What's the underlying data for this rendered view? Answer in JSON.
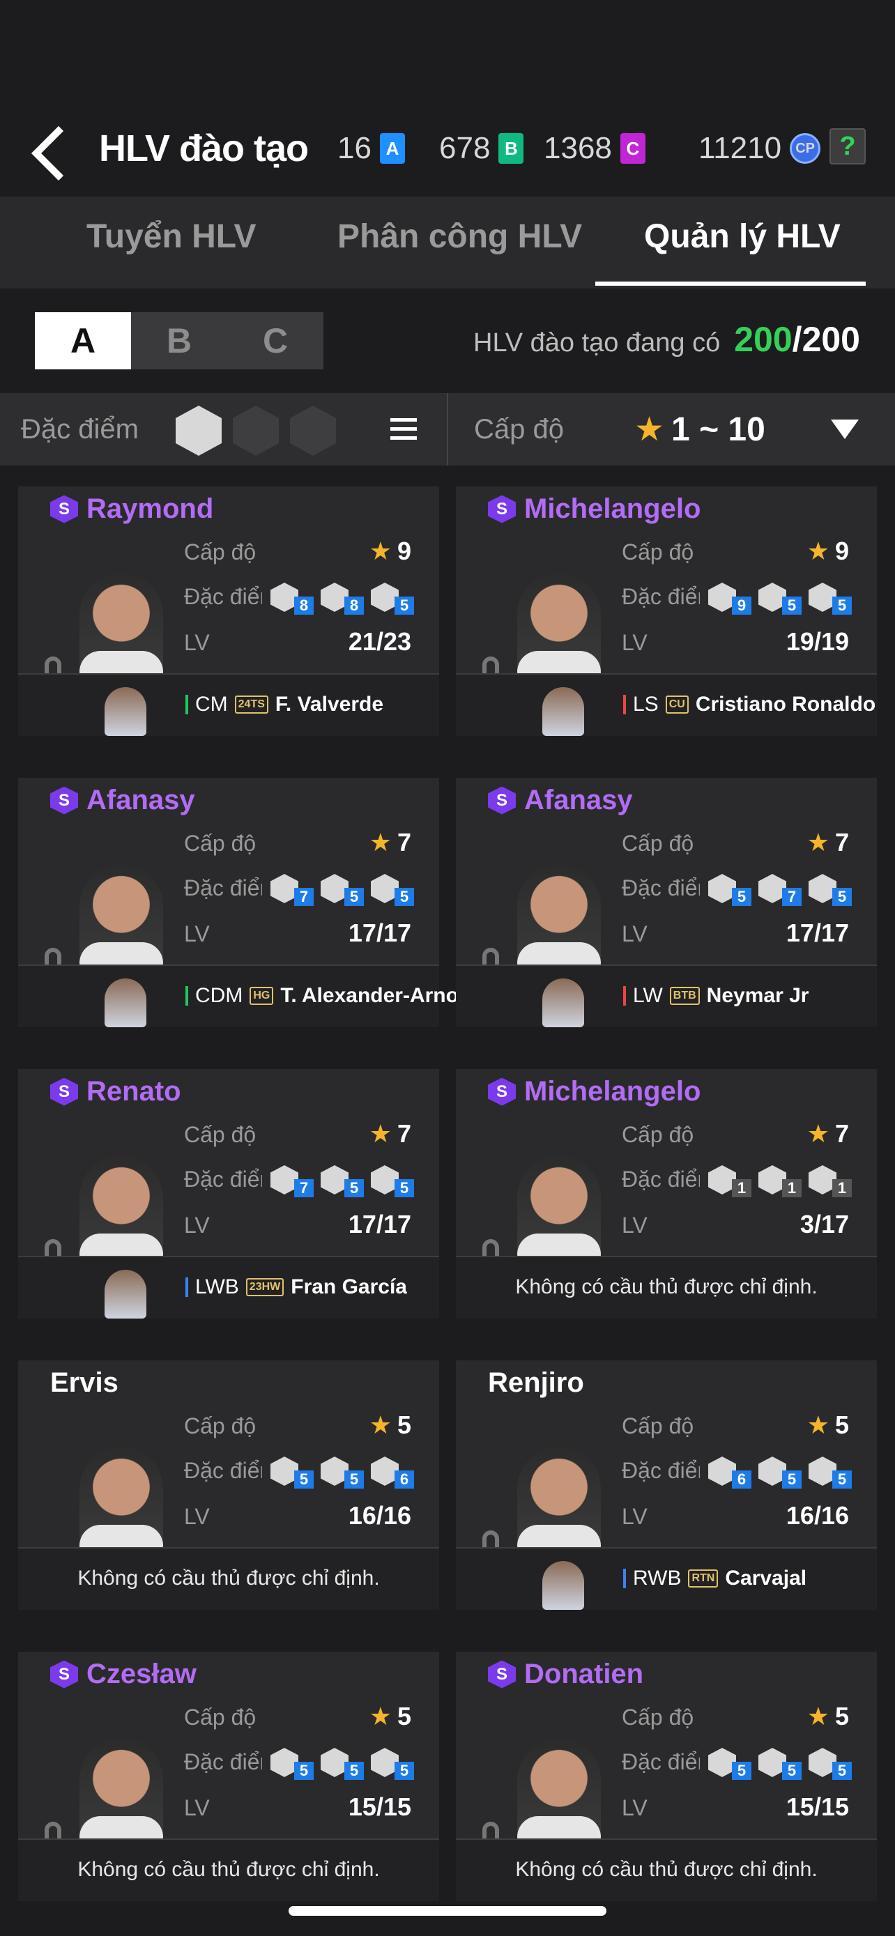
{
  "header": {
    "title": "HLV đào tạo",
    "currencies": [
      {
        "value": "16",
        "badge": "A",
        "color": "#1e90ff"
      },
      {
        "value": "678",
        "badge": "B",
        "color": "#10b981"
      },
      {
        "value": "1368",
        "badge": "C",
        "color": "#c026d3"
      },
      {
        "value": "11210",
        "badge": "CP",
        "color": "#3a6ee8"
      }
    ],
    "help": "?"
  },
  "tabs": [
    "Tuyển HLV",
    "Phân công HLV",
    "Quản lý HLV"
  ],
  "active_tab": "Quản lý HLV",
  "groups": [
    "A",
    "B",
    "C"
  ],
  "active_group": "A",
  "count": {
    "label": "HLV đào tạo đang có",
    "current": "200",
    "max": "/200"
  },
  "filter": {
    "trait_label": "Đặc điểm c",
    "level_label": "Cấp độ",
    "level_range": "1 ~ 10"
  },
  "labels": {
    "level": "Cấp độ",
    "traits": "Đặc điểm",
    "lv": "LV",
    "none": "Không có cầu thủ được chỉ định."
  },
  "coaches": [
    {
      "name": "Raymond",
      "special": true,
      "level": "9",
      "lv": "21/23",
      "traits": [
        "8",
        "8",
        "5"
      ],
      "pos": "CM",
      "season": "24TS",
      "player": "F. Valverde",
      "pos_color": "#22c55e"
    },
    {
      "name": "Michelangelo",
      "special": true,
      "level": "9",
      "lv": "19/19",
      "traits": [
        "9",
        "5",
        "5"
      ],
      "pos": "LS",
      "season": "CU",
      "player": "Cristiano Ronaldo",
      "pos_color": "#ef4444"
    },
    {
      "name": "Afanasy",
      "special": true,
      "level": "7",
      "lv": "17/17",
      "traits": [
        "7",
        "5",
        "5"
      ],
      "pos": "CDM",
      "season": "HG",
      "player": "T. Alexander-Arnold",
      "pos_color": "#22c55e"
    },
    {
      "name": "Afanasy",
      "special": true,
      "level": "7",
      "lv": "17/17",
      "traits": [
        "5",
        "7",
        "5"
      ],
      "pos": "LW",
      "season": "BTB",
      "player": "Neymar Jr",
      "pos_color": "#ef4444"
    },
    {
      "name": "Renato",
      "special": true,
      "level": "7",
      "lv": "17/17",
      "traits": [
        "7",
        "5",
        "5"
      ],
      "pos": "LWB",
      "season": "23HW",
      "player": "Fran García",
      "pos_color": "#3b82f6"
    },
    {
      "name": "Michelangelo",
      "special": true,
      "level": "7",
      "lv": "3/17",
      "traits": [
        "1",
        "1",
        "1"
      ],
      "pos": "",
      "season": "",
      "player": "",
      "pos_color": ""
    },
    {
      "name": "Ervis",
      "special": false,
      "level": "5",
      "lv": "16/16",
      "traits": [
        "5",
        "5",
        "6"
      ],
      "pos": "",
      "season": "",
      "player": "",
      "pos_color": ""
    },
    {
      "name": "Renjiro",
      "special": false,
      "level": "5",
      "lv": "16/16",
      "traits": [
        "6",
        "5",
        "5"
      ],
      "pos": "RWB",
      "season": "RTN",
      "player": "Carvajal",
      "pos_color": "#3b82f6"
    },
    {
      "name": "Czesław",
      "special": true,
      "level": "5",
      "lv": "15/15",
      "traits": [
        "5",
        "5",
        "5"
      ],
      "pos": "",
      "season": "",
      "player": "",
      "pos_color": ""
    },
    {
      "name": "Donatien",
      "special": true,
      "level": "5",
      "lv": "15/15",
      "traits": [
        "5",
        "5",
        "5"
      ],
      "pos": "",
      "season": "",
      "player": "",
      "pos_color": ""
    }
  ]
}
